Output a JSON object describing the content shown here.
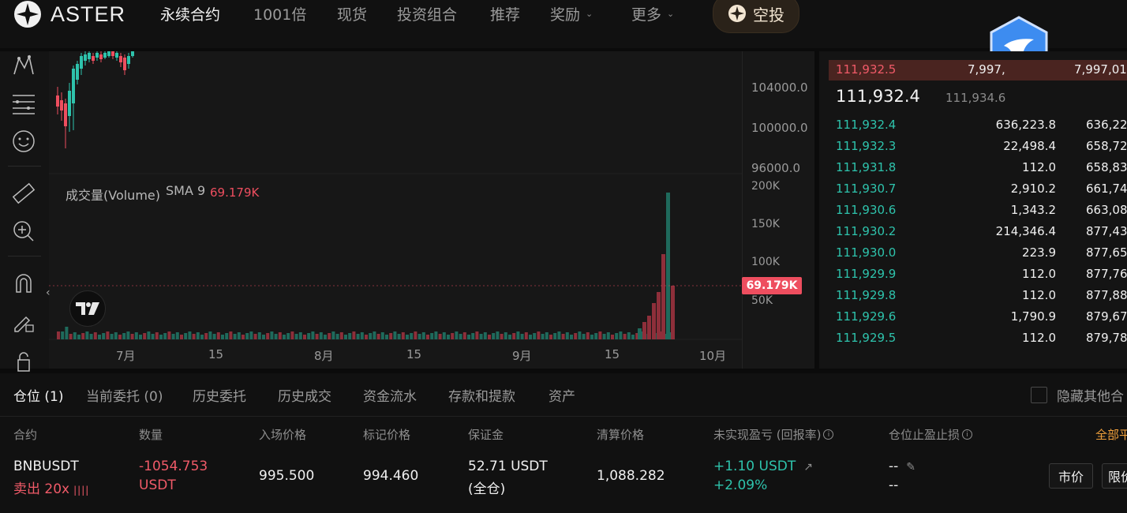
{
  "nav": {
    "brand": "ASTER",
    "items": [
      {
        "label": "永续合约",
        "active": true,
        "has_dropdown": false
      },
      {
        "label": "1001倍",
        "active": false,
        "has_dropdown": false
      },
      {
        "label": "现货",
        "active": false,
        "has_dropdown": false
      },
      {
        "label": "投资组合",
        "active": false,
        "has_dropdown": false
      },
      {
        "label": "推荐",
        "active": false,
        "has_dropdown": false
      },
      {
        "label": "奖励",
        "active": false,
        "has_dropdown": true
      },
      {
        "label": "更多",
        "active": false,
        "has_dropdown": true
      }
    ],
    "airdrop_label": "空投"
  },
  "chart": {
    "price_axis": [
      "104000.0",
      "100000.0",
      "96000.0"
    ],
    "volume_axis": [
      "200K",
      "150K",
      "100K",
      "50K"
    ],
    "volume_title": "成交量(Volume)",
    "volume_sma": "SMA 9",
    "volume_value": "69.179K",
    "volume_current_tag": "69.179K",
    "time_labels": [
      "7月",
      "15",
      "8月",
      "15",
      "9月",
      "15",
      "10月"
    ],
    "colors": {
      "up": "#2ec3ac",
      "down": "#ee4e5f",
      "volume_up": "#1f6a5c",
      "volume_down": "#8e2f3a"
    }
  },
  "orderbook": {
    "ask_highlight": {
      "price": "111,932.5",
      "amount": "7,997,",
      "total": "7,997,01"
    },
    "last_price": "111,932.4",
    "mark_price": "111,934.6",
    "bids": [
      {
        "price": "111,932.4",
        "amount": "636,223.8",
        "total": "636,22"
      },
      {
        "price": "111,932.3",
        "amount": "22,498.4",
        "total": "658,72"
      },
      {
        "price": "111,931.8",
        "amount": "112.0",
        "total": "658,83"
      },
      {
        "price": "111,930.7",
        "amount": "2,910.2",
        "total": "661,74"
      },
      {
        "price": "111,930.6",
        "amount": "1,343.2",
        "total": "663,08"
      },
      {
        "price": "111,930.2",
        "amount": "214,346.4",
        "total": "877,43"
      },
      {
        "price": "111,930.0",
        "amount": "223.9",
        "total": "877,65"
      },
      {
        "price": "111,929.9",
        "amount": "112.0",
        "total": "877,76"
      },
      {
        "price": "111,929.8",
        "amount": "112.0",
        "total": "877,88"
      },
      {
        "price": "111,929.6",
        "amount": "1,790.9",
        "total": "879,67"
      },
      {
        "price": "111,929.5",
        "amount": "112.0",
        "total": "879,78"
      }
    ]
  },
  "tabs": [
    {
      "label": "仓位 (1)",
      "active": true
    },
    {
      "label": "当前委托 (0)",
      "active": false
    },
    {
      "label": "历史委托",
      "active": false
    },
    {
      "label": "历史成交",
      "active": false
    },
    {
      "label": "资金流水",
      "active": false
    },
    {
      "label": "存款和提款",
      "active": false
    },
    {
      "label": "资产",
      "active": false
    }
  ],
  "hide_others_label": "隐藏其他合",
  "columns": {
    "contract": "合约",
    "quantity": "数量",
    "entry_price": "入场价格",
    "mark_price": "标记价格",
    "margin": "保证金",
    "liq_price": "清算价格",
    "pnl": "未实现盈亏 (回报率)",
    "tpsl": "仓位止盈止损",
    "close_all": "全部平"
  },
  "position": {
    "symbol": "BNBUSDT",
    "side_leverage": "卖出 20x",
    "quantity": "-1054.753",
    "quantity_unit": "USDT",
    "entry_price": "995.500",
    "mark_price": "994.460",
    "margin": "52.71 USDT",
    "margin_mode": "(全仓)",
    "liq_price": "1,088.282",
    "pnl": "+1.10 USDT",
    "roe": "+2.09%",
    "tp": "--",
    "sl": "--",
    "market_button": "市价",
    "limit_button": "限价"
  }
}
